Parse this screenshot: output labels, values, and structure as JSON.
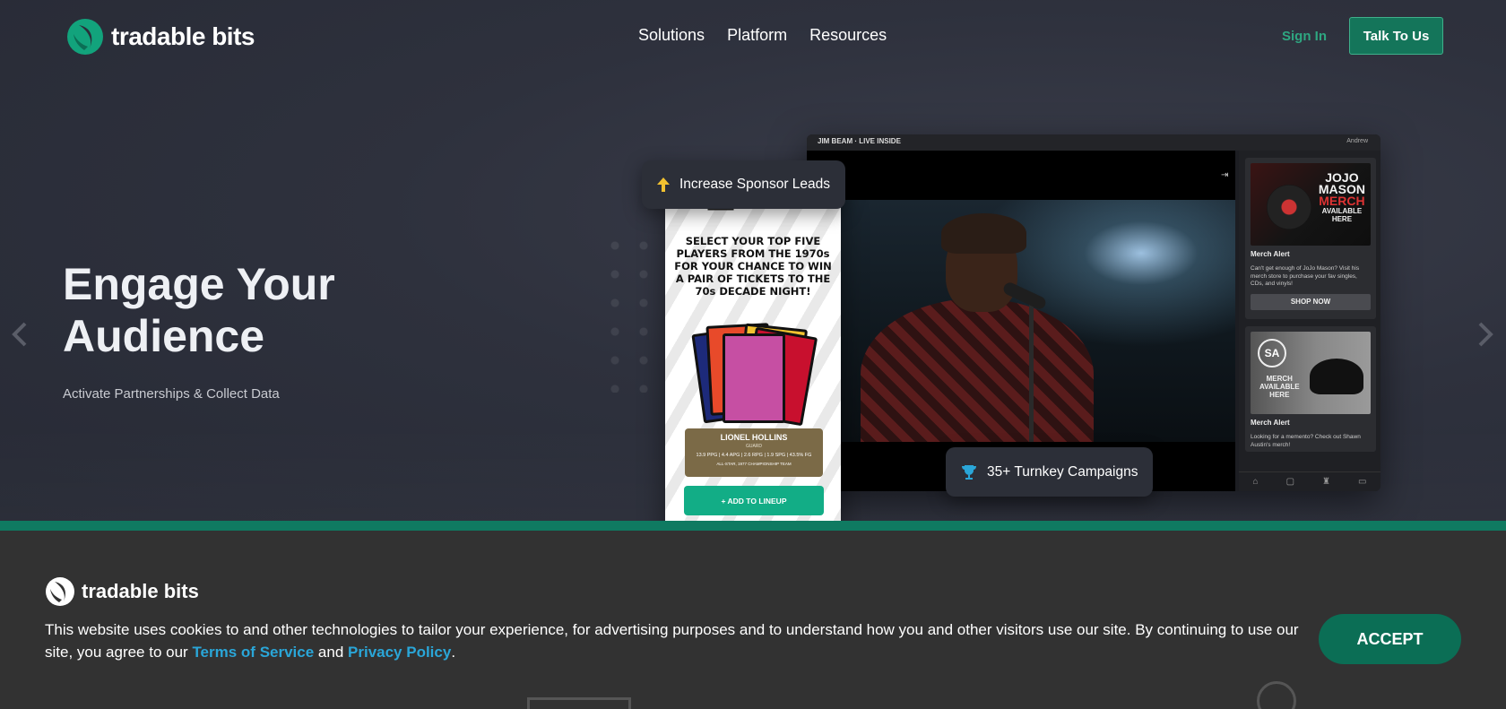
{
  "header": {
    "logo_text": "tradable bits",
    "nav": [
      "Solutions",
      "Platform",
      "Resources"
    ],
    "sign_in": "Sign In",
    "talk_button": "Talk To Us"
  },
  "hero": {
    "title": "Engage Your Audience",
    "subtitle": "Activate Partnerships & Collect Data",
    "chip_leads": "Increase Sponsor Leads",
    "chip_campaigns": "35+ Turnkey Campaigns"
  },
  "monitor": {
    "brand": "JIM BEAM · LIVE INSIDE",
    "user": "Andrew",
    "card1": {
      "img_line1": "JOJO",
      "img_line2": "MASON",
      "img_line3": "MERCH",
      "img_line4": "AVAILABLE",
      "img_line5": "HERE",
      "title": "Merch Alert",
      "text": "Can't get enough of JoJo Mason? Visit his merch store to purchase your fav singles, CDs, and vinyls!",
      "button": "SHOP NOW"
    },
    "card2": {
      "img_mono": "SA",
      "img_line1": "MERCH",
      "img_line2": "AVAILABLE",
      "img_line3": "HERE",
      "title": "Merch Alert",
      "text": "Looking for a memento? Check out Shawn Austin's merch!"
    }
  },
  "phone": {
    "headline": "SELECT YOUR TOP FIVE PLAYERS FROM THE 1970s FOR YOUR CHANCE TO WIN A PAIR OF TICKETS TO THE 70s DECADE NIGHT!",
    "player_name": "LIONEL HOLLINS",
    "player_pos": "GUARD",
    "player_stats": "13.9 PPG | 4.4 APG | 2.6 RPG | 1.9 SPG | 43.5% FG",
    "player_note": "ALL-STAR, 1977 CHAMPIONSHIP TEAM",
    "lineup_button": "+ ADD TO LINEUP"
  },
  "cookie": {
    "logo_text": "tradable bits",
    "text_before": "This website uses cookies to and other technologies to tailor your experience, for advertising purposes and to understand how you and other visitors use our site. By continuing to use our site, you agree to our ",
    "terms": "Terms of Service",
    "and": " and ",
    "privacy": "Privacy Policy",
    "period": ".",
    "accept": "ACCEPT"
  },
  "colors": {
    "accent_green": "#0f7a61",
    "link_blue": "#2aa6d8",
    "signin_green": "#2ea781"
  }
}
